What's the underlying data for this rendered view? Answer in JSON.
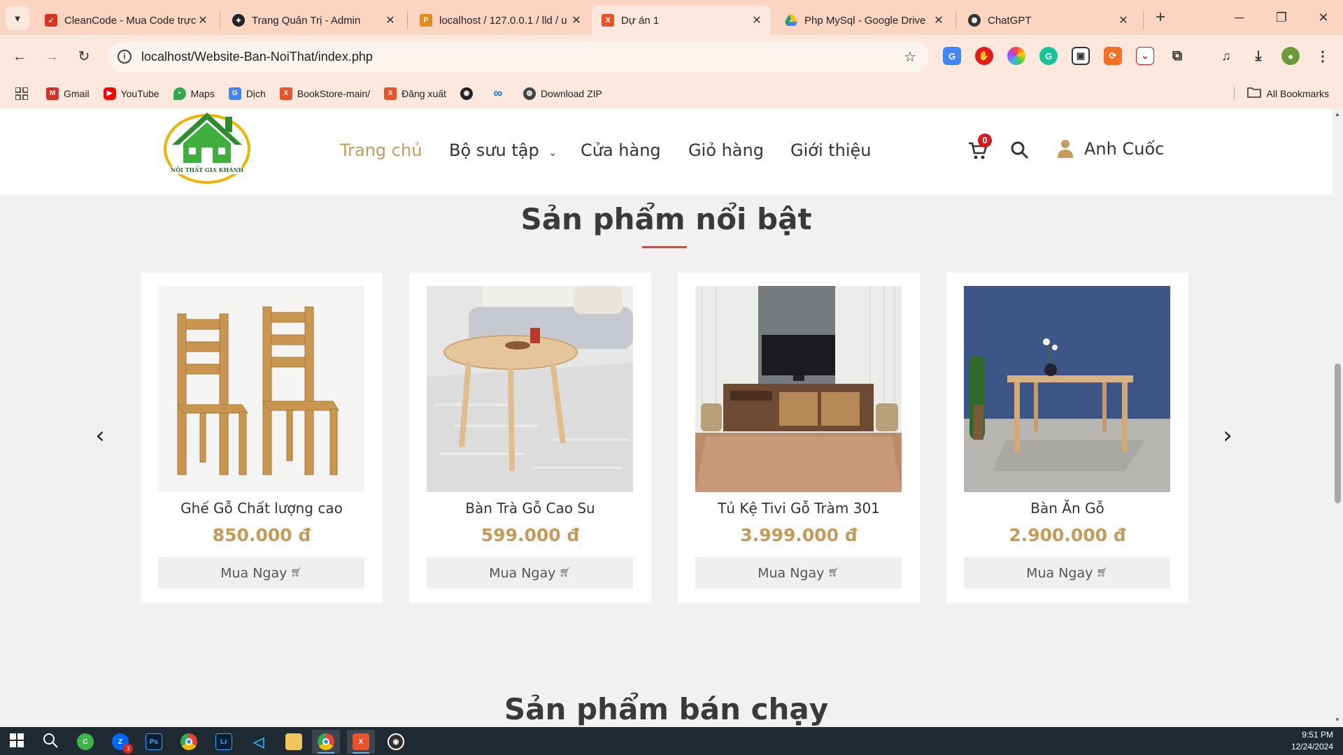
{
  "browser": {
    "tabs": [
      {
        "title": "CleanCode - Mua Code trực",
        "icon": "cleancode-icon",
        "color": "#d9341f"
      },
      {
        "title": "Trang Quản Trị - Admin",
        "icon": "admin-icon",
        "color": "#222222"
      },
      {
        "title": "localhost / 127.0.0.1 / lld / u",
        "icon": "phpmyadmin-icon",
        "color": "#e58a1a"
      },
      {
        "title": "Dự án 1",
        "icon": "xampp-icon",
        "color": "#e8532b",
        "active": true
      },
      {
        "title": "Php MySql - Google Drive",
        "icon": "google-drive-icon",
        "color": "#1fa463"
      },
      {
        "title": "ChatGPT",
        "icon": "chatgpt-icon",
        "color": "#333333"
      }
    ],
    "url": "localhost/Website-Ban-NoiThat/index.php",
    "bookmarks": [
      {
        "label": "Gmail",
        "icon": "gmail-icon",
        "color": "#d93025"
      },
      {
        "label": "YouTube",
        "icon": "youtube-icon",
        "color": "#ff0000"
      },
      {
        "label": "Maps",
        "icon": "maps-icon",
        "color": "#34a853"
      },
      {
        "label": "Dịch",
        "icon": "translate-icon",
        "color": "#4285f4"
      },
      {
        "label": "BookStore-main/",
        "icon": "xampp-icon",
        "color": "#e8532b"
      },
      {
        "label": "Đăng xuất",
        "icon": "xampp-icon",
        "color": "#e8532b"
      },
      {
        "label": "",
        "icon": "github-icon",
        "color": "#222222"
      },
      {
        "label": "",
        "icon": "meta-icon",
        "color": "#0866ff"
      },
      {
        "label": "Download ZIP",
        "icon": "globe-icon",
        "color": "#444444"
      }
    ],
    "all_bookmarks": "All Bookmarks"
  },
  "site": {
    "nav": {
      "home": "Trang chủ",
      "collection": "Bộ sưu tập",
      "shop": "Cửa hàng",
      "cart": "Giỏ hàng",
      "about": "Giới thiệu"
    },
    "cart_count": "0",
    "user_name": "Anh Cuốc",
    "accent_color": "#c49b5a",
    "featured_title": "Sản phẩm nổi bật",
    "bestseller_title": "Sản phẩm bán chạy",
    "buy_label": "Mua Ngay",
    "products": [
      {
        "name": "Ghế Gỗ Chất lượng cao",
        "price": "850.000 đ"
      },
      {
        "name": "Bàn Trà Gỗ Cao Su",
        "price": "599.000 đ"
      },
      {
        "name": "Tủ Kệ Tivi Gỗ Tràm 301",
        "price": "3.999.000 đ"
      },
      {
        "name": "Bàn Ăn Gỗ",
        "price": "2.900.000 đ"
      }
    ]
  },
  "taskbar": {
    "time": "9:51 PM",
    "date": "12/24/2024",
    "zalo_badge": "3"
  }
}
